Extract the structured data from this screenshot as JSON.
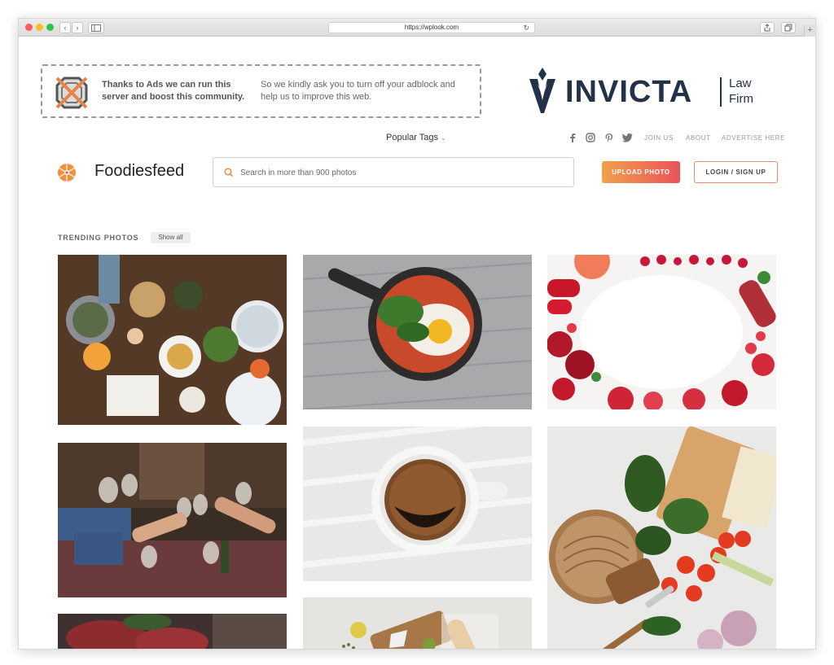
{
  "browser": {
    "url": "https://wplook.com",
    "nav_back": "‹",
    "nav_forward": "›",
    "reload": "↻",
    "new_tab": "+"
  },
  "ad_notice": {
    "text_left": "Thanks to Ads we can run this server and boost this community.",
    "text_right": "So we kindly ask you to turn off your adblock and help us to improve this web."
  },
  "sponsor": {
    "name": "INVICTA",
    "sub_line1": "Law",
    "sub_line2": "Firm",
    "color": "#223349"
  },
  "header": {
    "popular_tags": "Popular Tags",
    "nav": [
      "JOIN US",
      "ABOUT",
      "ADVERTISE HERE"
    ],
    "social_icons": [
      "facebook-icon",
      "instagram-icon",
      "pinterest-icon",
      "twitter-icon"
    ]
  },
  "brand": {
    "name": "Foodiesfeed"
  },
  "search": {
    "placeholder": "Search in more than 900 photos",
    "value": ""
  },
  "actions": {
    "upload": "UPLOAD PHOTO",
    "login": "LOGIN / SIGN UP",
    "accent_start": "#f2a04c",
    "accent_end": "#e8535c"
  },
  "trending": {
    "title": "TRENDING PHOTOS",
    "show_all": "Show all",
    "photos": [
      "dinner-table-photo",
      "skillet-egg-photo",
      "vegetable-frame-photo",
      "wine-toast-photo",
      "coffee-cup-photo",
      "bread-vegetables-photo",
      "raw-meat-photo",
      "cheese-board-photo"
    ]
  }
}
